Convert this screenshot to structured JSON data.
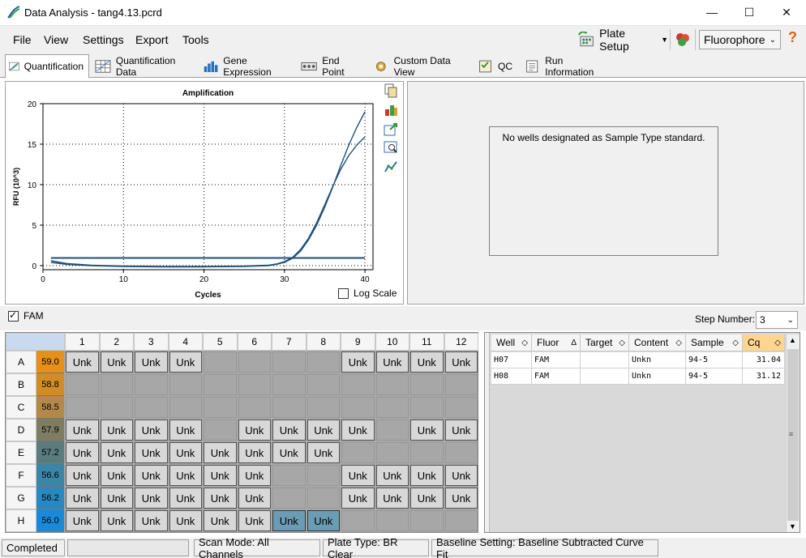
{
  "window": {
    "title": "Data Analysis - tang4.13.pcrd",
    "minimize": "—",
    "maximize": "☐",
    "close": "✕"
  },
  "menu": {
    "items": [
      "File",
      "View",
      "Settings",
      "Export",
      "Tools"
    ],
    "plate_setup": "Plate Setup",
    "fluorophore": "Fluorophore",
    "help": "?"
  },
  "tabs": [
    "Quantification",
    "Quantification Data",
    "Gene Expression",
    "End Point",
    "Custom Data View",
    "QC",
    "Run Information"
  ],
  "chart_data": {
    "type": "line",
    "title": "Amplification",
    "xlabel": "Cycles",
    "ylabel": "RFU (10^3)",
    "xlim": [
      0,
      41
    ],
    "ylim": [
      -0.5,
      20
    ],
    "xticks": [
      0,
      10,
      20,
      30,
      40
    ],
    "yticks": [
      0,
      5,
      10,
      15,
      20
    ],
    "grid": true,
    "log_scale": false,
    "series": [
      {
        "x": [
          1,
          3,
          6,
          10,
          15,
          20,
          25,
          28,
          29,
          30,
          31,
          32,
          33,
          34,
          35,
          36,
          37,
          38,
          39,
          40
        ],
        "y": [
          0.4,
          0.15,
          0.0,
          -0.1,
          -0.15,
          -0.15,
          -0.1,
          0.0,
          0.15,
          0.4,
          0.9,
          1.8,
          3.2,
          5.0,
          7.2,
          9.7,
          12.4,
          14.9,
          17.1,
          19.0
        ]
      },
      {
        "x": [
          1,
          3,
          6,
          10,
          15,
          20,
          25,
          28,
          29,
          30,
          31,
          32,
          33,
          34,
          35,
          36,
          37,
          38,
          39,
          40
        ],
        "y": [
          0.6,
          0.25,
          0.05,
          -0.05,
          -0.1,
          -0.1,
          -0.05,
          0.05,
          0.2,
          0.5,
          1.0,
          2.0,
          3.4,
          5.3,
          7.5,
          9.8,
          11.9,
          13.6,
          14.9,
          15.9
        ]
      }
    ],
    "threshold": 0.95,
    "log_scale_label": "Log Scale"
  },
  "std_message": "No wells designated as Sample Type standard.",
  "fluor_checkbox": "FAM",
  "step_number": {
    "label": "Step Number:",
    "value": "3"
  },
  "plate": {
    "cols": [
      "1",
      "2",
      "3",
      "4",
      "5",
      "6",
      "7",
      "8",
      "9",
      "10",
      "11",
      "12"
    ],
    "rows": [
      {
        "label": "A",
        "temp": "59.0",
        "color": "#e4901a",
        "wells": [
          "Unk",
          "Unk",
          "Unk",
          "Unk",
          "",
          "",
          "",
          "",
          "Unk",
          "Unk",
          "Unk",
          "Unk"
        ]
      },
      {
        "label": "B",
        "temp": "58.8",
        "color": "#d08c26",
        "wells": [
          "",
          "",
          "",
          "",
          "",
          "",
          "",
          "",
          "",
          "",
          "",
          ""
        ]
      },
      {
        "label": "C",
        "temp": "58.5",
        "color": "#b3894a",
        "wells": [
          "",
          "",
          "",
          "",
          "",
          "",
          "",
          "",
          "",
          "",
          "",
          ""
        ]
      },
      {
        "label": "D",
        "temp": "57.9",
        "color": "#7e7d62",
        "wells": [
          "Unk",
          "Unk",
          "Unk",
          "Unk",
          "",
          "Unk",
          "Unk",
          "Unk",
          "Unk",
          "",
          "Unk",
          "Unk"
        ]
      },
      {
        "label": "E",
        "temp": "57.2",
        "color": "#5b7c7e",
        "wells": [
          "Unk",
          "Unk",
          "Unk",
          "Unk",
          "Unk",
          "Unk",
          "Unk",
          "Unk",
          "",
          "",
          "",
          ""
        ]
      },
      {
        "label": "F",
        "temp": "56.6",
        "color": "#3c85a6",
        "wells": [
          "Unk",
          "Unk",
          "Unk",
          "Unk",
          "Unk",
          "Unk",
          "",
          "",
          "Unk",
          "Unk",
          "Unk",
          "Unk"
        ]
      },
      {
        "label": "G",
        "temp": "56.2",
        "color": "#2a88c0",
        "wells": [
          "Unk",
          "Unk",
          "Unk",
          "Unk",
          "Unk",
          "Unk",
          "",
          "",
          "Unk",
          "Unk",
          "Unk",
          "Unk"
        ]
      },
      {
        "label": "H",
        "temp": "56.0",
        "color": "#1a8ad8",
        "wells": [
          "Unk",
          "Unk",
          "Unk",
          "Unk",
          "Unk",
          "Unk",
          "Unk*",
          "Unk*",
          "",
          "",
          "",
          ""
        ]
      }
    ]
  },
  "well_table": {
    "headers": [
      "Well",
      "Fluor",
      "Target",
      "Content",
      "Sample",
      "Cq"
    ],
    "rows": [
      [
        "H07",
        "FAM",
        "",
        "Unkn",
        "94-5",
        "31.04"
      ],
      [
        "H08",
        "FAM",
        "",
        "Unkn",
        "94-5",
        "31.12"
      ]
    ]
  },
  "status": {
    "state": "Completed",
    "scan_mode": "Scan Mode: All Channels",
    "plate_type": "Plate Type: BR Clear",
    "baseline": "Baseline Setting: Baseline Subtracted Curve Fit"
  }
}
